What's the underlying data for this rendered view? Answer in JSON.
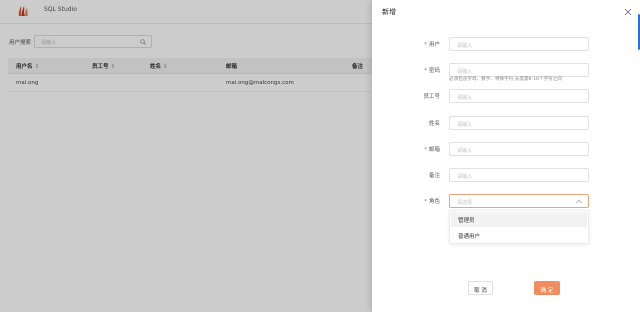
{
  "app": {
    "title": "SQL Studio"
  },
  "search": {
    "label": "用户搜索",
    "placeholder": "请输入"
  },
  "table": {
    "columns": [
      {
        "label": "用户名",
        "sortable": true
      },
      {
        "label": "员工号",
        "sortable": true
      },
      {
        "label": "姓名",
        "sortable": true
      },
      {
        "label": "邮箱",
        "sortable": false
      },
      {
        "label": "备注",
        "sortable": false
      }
    ],
    "sort_glyph": "⇕",
    "rows": [
      {
        "username": "mai.ong",
        "employee_id": "",
        "name": "",
        "email": "mai.ong@malcongs.com",
        "note": ""
      }
    ]
  },
  "drawer": {
    "title": "新增",
    "fields": [
      {
        "label": "用户",
        "required": true,
        "placeholder": "请输入"
      },
      {
        "label": "密码",
        "required": true,
        "placeholder": "请输入"
      },
      {
        "label": "员工号",
        "required": false,
        "placeholder": "请输入"
      },
      {
        "label": "姓名",
        "required": false,
        "placeholder": "请输入"
      },
      {
        "label": "邮箱",
        "required": true,
        "placeholder": "请输入"
      },
      {
        "label": "备注",
        "required": false,
        "placeholder": "请输入"
      },
      {
        "label": "角色",
        "required": true,
        "placeholder": "请选择"
      }
    ],
    "password_hint": "必须包含字母、数字、特殊字符,长度需8-16个字符之间",
    "role_options": [
      "管理员",
      "普通用户"
    ],
    "cancel_label": "取 消",
    "confirm_label": "确 定"
  },
  "colors": {
    "accent": "#ef8d5f",
    "required": "#e84c3d",
    "logo": "#e05a3a"
  },
  "icons": {
    "logo": "flame-logo-icon",
    "search": "search-icon",
    "close": "close-icon",
    "select": "chevron-up-icon"
  }
}
